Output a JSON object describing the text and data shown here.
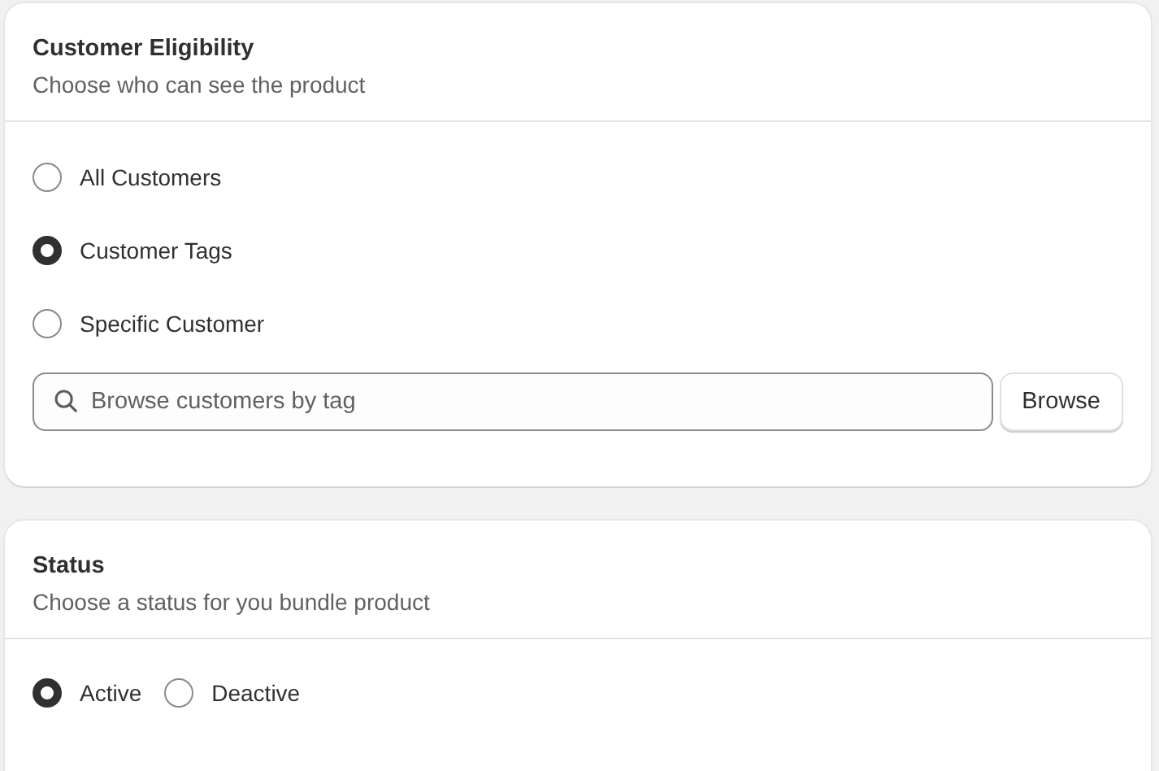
{
  "eligibility": {
    "title": "Customer Eligibility",
    "subtitle": "Choose who can see the product",
    "options": [
      {
        "label": "All Customers",
        "selected": false
      },
      {
        "label": "Customer Tags",
        "selected": true
      },
      {
        "label": "Specific Customer",
        "selected": false
      }
    ],
    "search": {
      "placeholder": "Browse customers by tag"
    },
    "browse_button": "Browse"
  },
  "status": {
    "title": "Status",
    "subtitle": "Choose a status for you bundle product",
    "options": [
      {
        "label": "Active",
        "selected": true
      },
      {
        "label": "Deactive",
        "selected": false
      }
    ]
  }
}
